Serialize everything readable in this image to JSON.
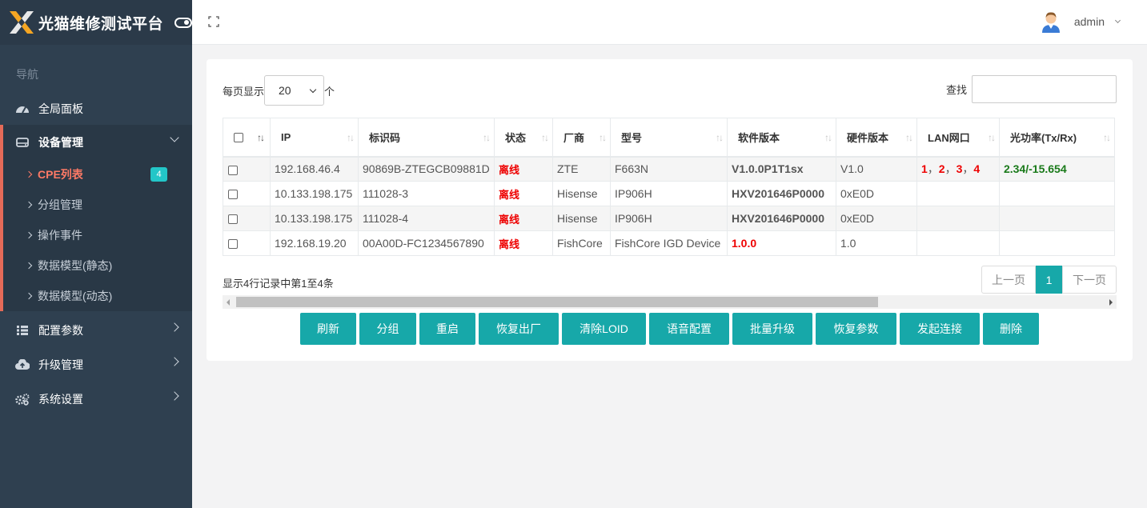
{
  "brand": {
    "title": "光猫维修测试平台"
  },
  "nav": {
    "heading": "导航",
    "dashboard": "全局面板",
    "device_mgmt": "设备管理",
    "sub": [
      "CPE列表",
      "分组管理",
      "操作事件",
      "数据模型(静态)",
      "数据模型(动态)"
    ],
    "cpe_badge": "4",
    "config": "配置参数",
    "upgrade": "升级管理",
    "system": "系统设置"
  },
  "header": {
    "username": "admin"
  },
  "table_controls": {
    "per_page_prefix": "每页显示",
    "per_page_value": "20",
    "per_page_suffix": "个",
    "search_label": "查找",
    "search_value": ""
  },
  "table": {
    "columns": [
      "IP",
      "标识码",
      "状态",
      "厂商",
      "型号",
      "软件版本",
      "硬件版本",
      "LAN网口",
      "光功率(Tx/Rx)"
    ],
    "rows": [
      {
        "ip": "192.168.46.4",
        "id": "90869B-ZTEGCB09881D",
        "status": "离线",
        "vendor": "ZTE",
        "model": "F663N",
        "sw": "V1.0.0P1T1sx",
        "hw": "V1.0",
        "lan": [
          "1",
          "2",
          "3",
          "4"
        ],
        "optical": "2.34/-15.654"
      },
      {
        "ip": "10.133.198.175",
        "id": "111028-3",
        "status": "离线",
        "vendor": "Hisense",
        "model": "IP906H",
        "sw": "HXV201646P0000",
        "hw": "0xE0D",
        "lan": [],
        "optical": ""
      },
      {
        "ip": "10.133.198.175",
        "id": "111028-4",
        "status": "离线",
        "vendor": "Hisense",
        "model": "IP906H",
        "sw": "HXV201646P0000",
        "hw": "0xE0D",
        "lan": [],
        "optical": ""
      },
      {
        "ip": "192.168.19.20",
        "id": "00A00D-FC1234567890",
        "status": "离线",
        "vendor": "FishCore",
        "model": "FishCore IGD Device",
        "sw": "1.0.0",
        "hw": "1.0",
        "lan": [],
        "optical": ""
      }
    ]
  },
  "footer": {
    "info": "显示4行记录中第1至4条",
    "prev": "上一页",
    "page": "1",
    "next": "下一页"
  },
  "actions": [
    "刷新",
    "分组",
    "重启",
    "恢复出厂",
    "清除LOID",
    "语音配置",
    "批量升级",
    "恢复参数",
    "发起连接",
    "删除"
  ],
  "colors": {
    "sidebar": "#2f4050",
    "accent": "#17a8a9",
    "active": "#ff7a66",
    "offline": "#e00000",
    "optical": "#1a7a1a"
  }
}
